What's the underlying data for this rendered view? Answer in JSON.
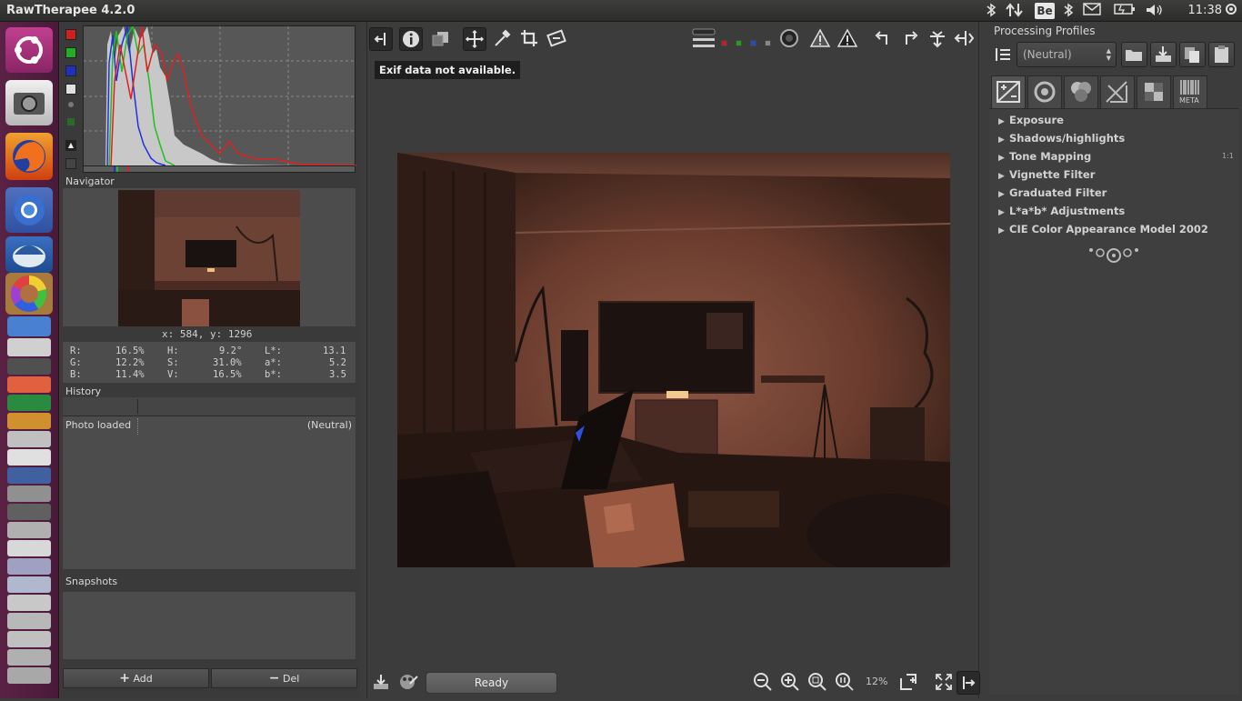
{
  "window": {
    "title": "RawTherapee 4.2.0"
  },
  "tray": {
    "keyboard": "Be",
    "clock": "11:38"
  },
  "launcher": {
    "apps": [
      "ubuntu-dash-icon",
      "camera-icon",
      "firefox-icon",
      "chromium-icon",
      "thunderbird-icon",
      "color-wheel-icon",
      "app-stack-icon"
    ]
  },
  "left_panel": {
    "navigator_title": "Navigator",
    "coords": "x: 584, y: 1296",
    "readout": {
      "r_label": "R:",
      "r_value": "16.5%",
      "g_label": "G:",
      "g_value": "12.2%",
      "b_label": "B:",
      "b_value": "11.4%",
      "h_label": "H:",
      "h_value": "9.2°",
      "s_label": "S:",
      "s_value": "31.0%",
      "v_label": "V:",
      "v_value": "16.5%",
      "l_label": "L*:",
      "l_value": "13.1",
      "a_label": "a*:",
      "a_value": "5.2",
      "bb_label": "b*:",
      "bb_value": "3.5"
    },
    "history_title": "History",
    "history_row": {
      "name": "Photo loaded",
      "profile": "(Neutral)"
    },
    "snapshots_title": "Snapshots",
    "add_label": "Add",
    "del_label": "Del"
  },
  "editor": {
    "exif_notice": "Exif data not available.",
    "status": "Ready",
    "zoom": "12%"
  },
  "right_panel": {
    "title": "Processing Profiles",
    "profile_value": "(Neutral)",
    "tab_meta": "META",
    "tools": [
      "Exposure",
      "Shadows/highlights",
      "Tone Mapping",
      "Vignette Filter",
      "Graduated Filter",
      "L*a*b* Adjustments",
      "CIE Color Appearance Model 2002"
    ],
    "badge": "1:1"
  },
  "colors": {
    "launcher": "#5a2244",
    "histogram_red": "#e02020",
    "histogram_green": "#20c020",
    "histogram_blue": "#2030e0"
  }
}
